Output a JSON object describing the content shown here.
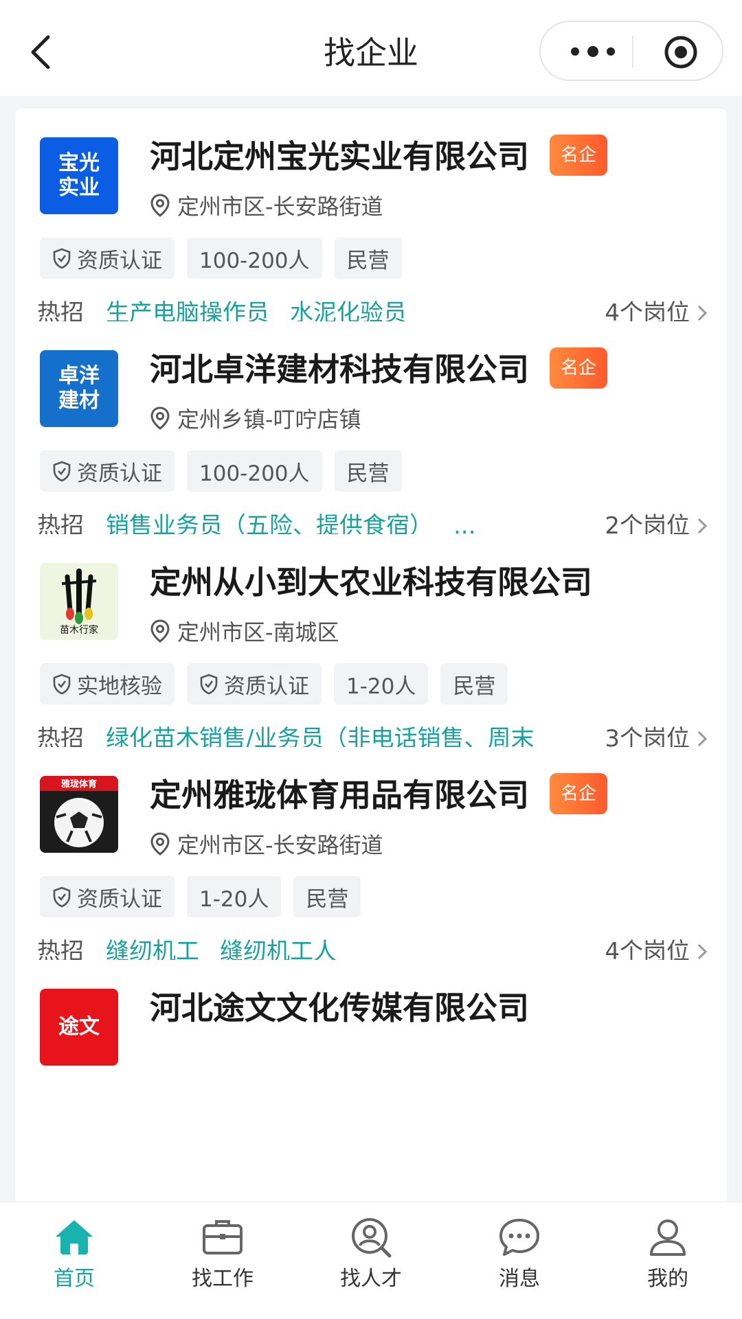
{
  "header": {
    "title": "找企业"
  },
  "companies": [
    {
      "logo_text": [
        "宝光",
        "实业"
      ],
      "logo_color": "#0b5de4",
      "name": "河北定州宝光实业有限公司",
      "badge": "名企",
      "location": "定州市区-长安路街道",
      "tags": [
        "资质认证",
        "100-200人",
        "民营"
      ],
      "hot_label": "热招",
      "hot_jobs": [
        "生产电脑操作员",
        "水泥化验员"
      ],
      "positions": "4个岗位"
    },
    {
      "logo_text": [
        "卓洋",
        "建材"
      ],
      "logo_color": "#1570cc",
      "name": "河北卓洋建材科技有限公司",
      "badge": "名企",
      "location": "定州乡镇-叮咛店镇",
      "tags": [
        "资质认证",
        "100-200人",
        "民营"
      ],
      "hot_label": "热招",
      "hot_jobs": [
        "销售业务员（五险、提供食宿）",
        "..."
      ],
      "positions": "2个岗位"
    },
    {
      "logo_caption": "苗木行家",
      "name": "定州从小到大农业科技有限公司",
      "location": "定州市区-南城区",
      "tags": [
        "实地核验",
        "资质认证",
        "1-20人",
        "民营"
      ],
      "hot_label": "热招",
      "hot_jobs": [
        "绿化苗木销售/业务员（非电话销售、周末"
      ],
      "positions": "3个岗位"
    },
    {
      "logo_caption": "雅珑体育",
      "name": "定州雅珑体育用品有限公司",
      "badge": "名企",
      "location": "定州市区-长安路街道",
      "tags": [
        "资质认证",
        "1-20人",
        "民营"
      ],
      "hot_label": "热招",
      "hot_jobs": [
        "缝纫机工",
        "缝纫机工人"
      ],
      "positions": "4个岗位"
    },
    {
      "logo_text": [
        "途文",
        ""
      ],
      "logo_color": "#e8141b",
      "name": "河北途文文化传媒有限公司"
    }
  ],
  "tabs": [
    {
      "label": "首页",
      "icon": "home-icon",
      "active": true
    },
    {
      "label": "找工作",
      "icon": "briefcase-icon",
      "active": false
    },
    {
      "label": "找人才",
      "icon": "person-search-icon",
      "active": false
    },
    {
      "label": "消息",
      "icon": "message-icon",
      "active": false
    },
    {
      "label": "我的",
      "icon": "profile-icon",
      "active": false
    }
  ],
  "colors": {
    "accent": "#16a3a0",
    "badge": "#ff6a33"
  }
}
